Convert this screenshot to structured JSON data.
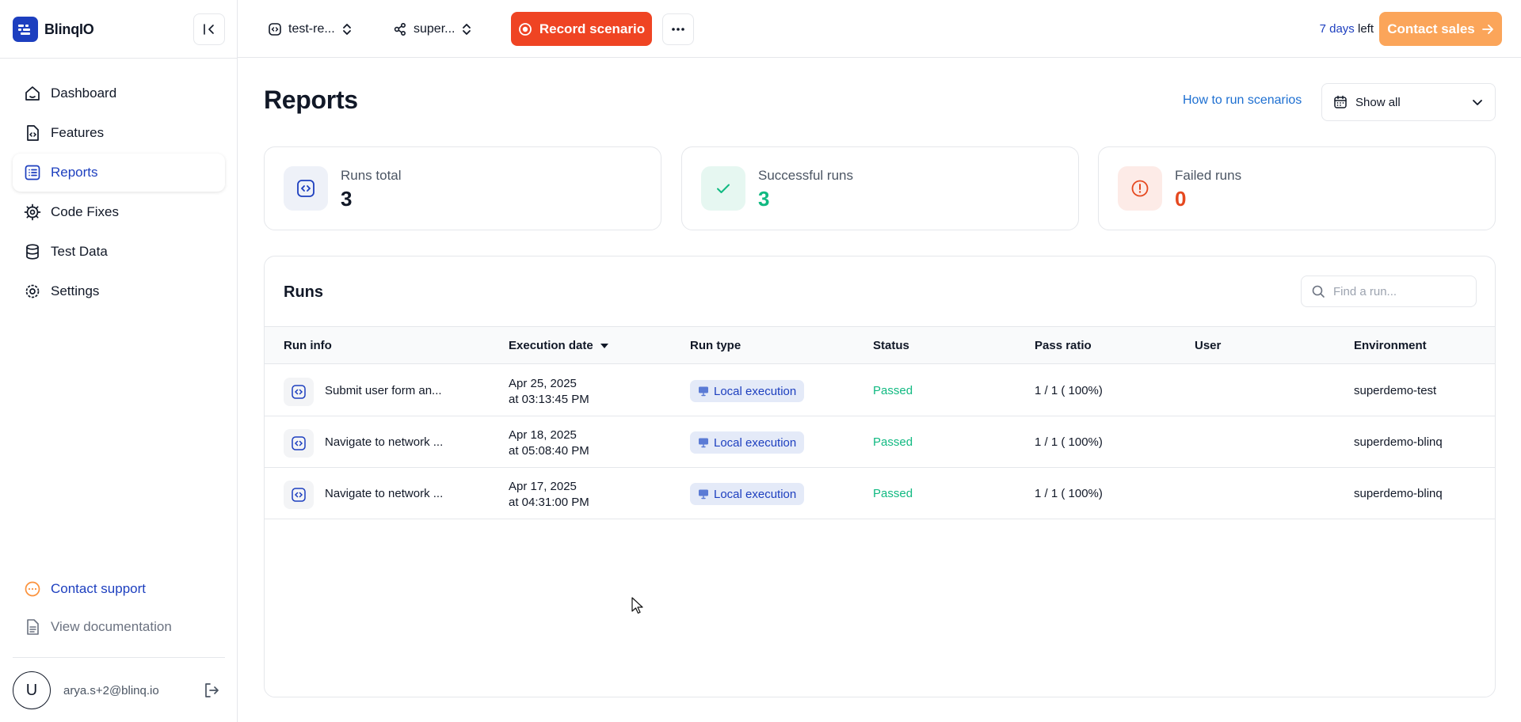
{
  "brand": {
    "name": "BlinqIO"
  },
  "sidebar": {
    "items": [
      {
        "label": "Dashboard",
        "icon": "home-icon"
      },
      {
        "label": "Features",
        "icon": "file-code-icon"
      },
      {
        "label": "Reports",
        "icon": "list-icon"
      },
      {
        "label": "Code Fixes",
        "icon": "cog-icon"
      },
      {
        "label": "Test Data",
        "icon": "database-icon"
      },
      {
        "label": "Settings",
        "icon": "gear-icon"
      }
    ],
    "active": "Reports",
    "contact_support": "Contact support",
    "view_documentation": "View documentation",
    "user": {
      "avatar_letter": "U",
      "email": "arya.s+2@blinq.io"
    }
  },
  "topbar": {
    "project_selector": "test-re...",
    "environment_selector": "super...",
    "record_button": "Record scenario",
    "trial": {
      "days": "7 days",
      "suffix": "left"
    },
    "contact_sales": "Contact sales"
  },
  "main": {
    "title": "Reports",
    "help_link": "How to run scenarios",
    "date_filter": "Show all",
    "stats": [
      {
        "label": "Runs total",
        "value": "3",
        "color": "#111827"
      },
      {
        "label": "Successful runs",
        "value": "3",
        "color": "#10b981"
      },
      {
        "label": "Failed runs",
        "value": "0",
        "color": "#e5481f"
      }
    ],
    "runs": {
      "title": "Runs",
      "search_placeholder": "Find a run...",
      "columns": [
        "Run info",
        "Execution date",
        "Run type",
        "Status",
        "Pass ratio",
        "User",
        "Environment"
      ],
      "rows": [
        {
          "name": "Submit user form an...",
          "date": "Apr 25, 2025",
          "time": "at 03:13:45 PM",
          "type": "Local execution",
          "status": "Passed",
          "ratio": "1 / 1 ( 100%)",
          "user": "",
          "env": "superdemo-test"
        },
        {
          "name": "Navigate to network ...",
          "date": "Apr 18, 2025",
          "time": "at 05:08:40 PM",
          "type": "Local execution",
          "status": "Passed",
          "ratio": "1 / 1 ( 100%)",
          "user": "",
          "env": "superdemo-blinq"
        },
        {
          "name": "Navigate to network ...",
          "date": "Apr 17, 2025",
          "time": "at 04:31:00 PM",
          "type": "Local execution",
          "status": "Passed",
          "ratio": "1 / 1 ( 100%)",
          "user": "",
          "env": "superdemo-blinq"
        }
      ]
    }
  },
  "colors": {
    "brand_blue": "#1d3fbf",
    "record_red": "#ef4423",
    "sales_orange": "#fba55a",
    "passed_green": "#10b981"
  }
}
